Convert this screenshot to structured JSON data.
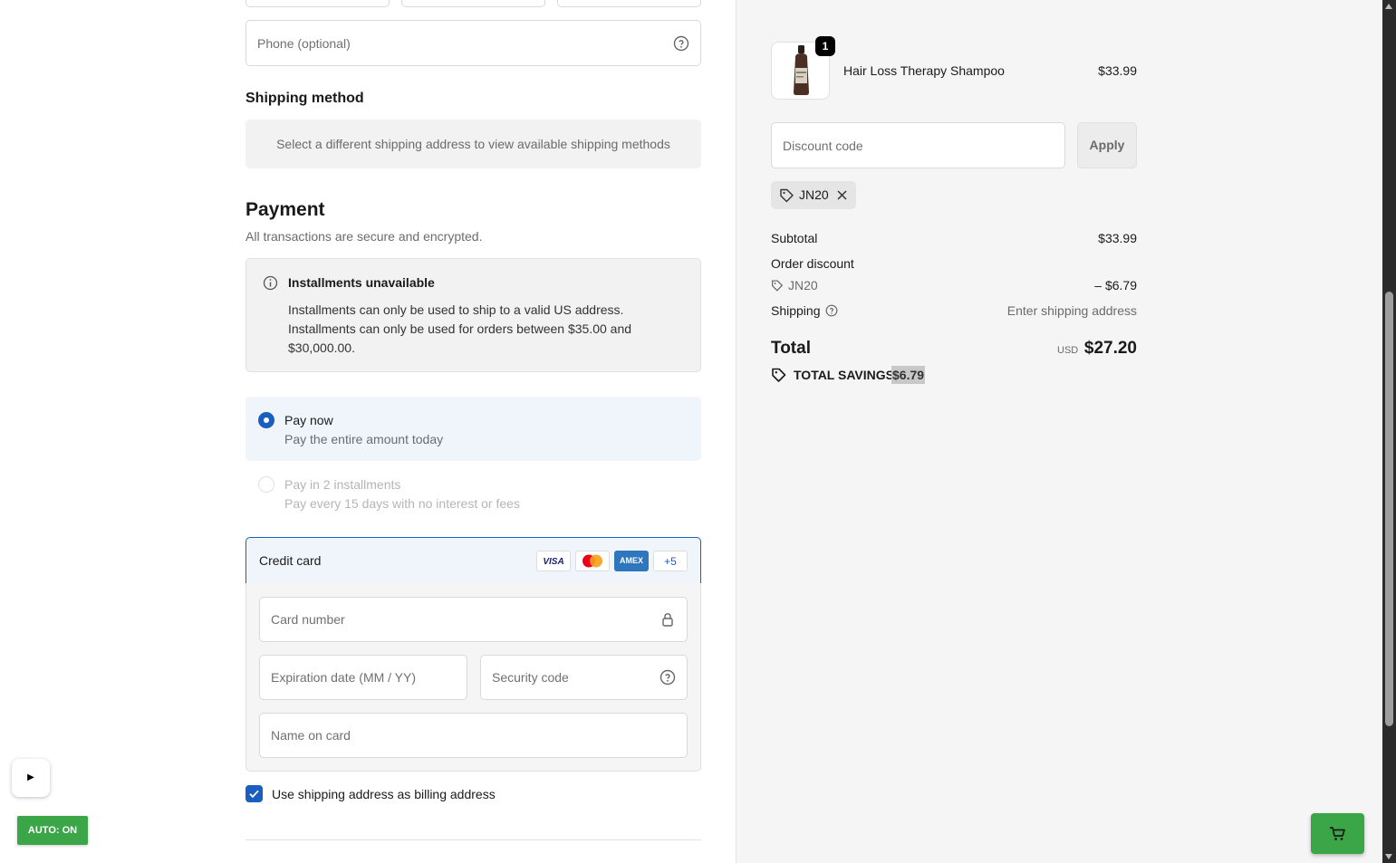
{
  "contact": {
    "phone_placeholder": "Phone (optional)"
  },
  "shipping_method": {
    "title": "Shipping method",
    "notice": "Select a different shipping address to view available shipping methods"
  },
  "payment": {
    "title": "Payment",
    "subtitle": "All transactions are secure and encrypted.",
    "installments_notice": {
      "title": "Installments unavailable",
      "lines": [
        "Installments can only be used to ship to a valid US address.",
        "Installments can only be used for orders between $35.00 and",
        "$30,000.00."
      ]
    },
    "options": [
      {
        "title": "Pay now",
        "subtitle": "Pay the entire amount today",
        "selected": true,
        "enabled": true
      },
      {
        "title": "Pay in 2 installments",
        "subtitle": "Pay every 15 days with no interest or fees",
        "selected": false,
        "enabled": false
      }
    ],
    "credit_card": {
      "label": "Credit card",
      "logos": [
        "VISA",
        "mastercard",
        "AMEX"
      ],
      "more_label": "+5",
      "card_number_placeholder": "Card number",
      "expiry_placeholder": "Expiration date (MM / YY)",
      "security_placeholder": "Security code",
      "name_placeholder": "Name on card"
    },
    "billing_checkbox_label": "Use shipping address as billing address",
    "billing_checkbox_checked": true
  },
  "order_summary": {
    "item": {
      "name": "Hair Loss Therapy Shampoo",
      "price": "$33.99",
      "quantity": "1"
    },
    "discount_placeholder": "Discount code",
    "apply_label": "Apply",
    "applied_code": "JN20",
    "subtotal_label": "Subtotal",
    "subtotal_value": "$33.99",
    "order_discount_label": "Order discount",
    "discount_code": "JN20",
    "discount_value": "– $6.79",
    "shipping_label": "Shipping",
    "shipping_value": "Enter shipping address",
    "total_label": "Total",
    "currency": "USD",
    "total_value": "$27.20",
    "savings_label": "TOTAL SAVINGS",
    "savings_value": "$6.79"
  },
  "overlay": {
    "play_label": "▶",
    "auto_label": "AUTO: ON"
  },
  "colors": {
    "accent": "#1a5fc0",
    "green": "#3aa648",
    "summary_bg": "#f5f5f5"
  }
}
